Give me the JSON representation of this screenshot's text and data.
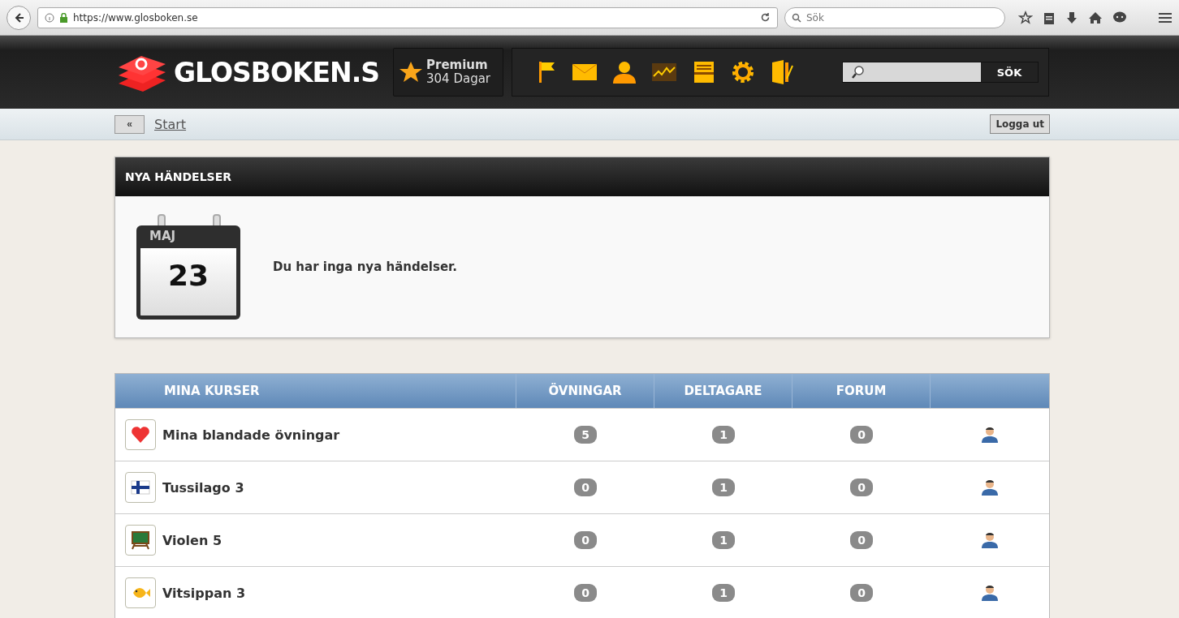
{
  "browser": {
    "url": "https://www.glosboken.se",
    "search_placeholder": "Sök"
  },
  "header": {
    "logo": "GLOSBOKEN.S",
    "premium": {
      "title": "Premium",
      "days": "304 Dagar"
    },
    "search": {
      "button": "SÖK"
    }
  },
  "breadcrumb": {
    "back": "«",
    "link": "Start",
    "logout": "Logga ut"
  },
  "events": {
    "title": "NYA HÄNDELSER",
    "calendar": {
      "month": "MAJ",
      "day": "23"
    },
    "message": "Du har inga nya händelser."
  },
  "courses": {
    "columns": [
      "MINA KURSER",
      "ÖVNINGAR",
      "DELTAGARE",
      "FORUM"
    ],
    "rows": [
      {
        "kind": "heart",
        "name": "Mina blandade övningar",
        "exercises": "5",
        "participants": "1",
        "forum": "0"
      },
      {
        "kind": "flag",
        "name": "Tussilago 3",
        "exercises": "0",
        "participants": "1",
        "forum": "0"
      },
      {
        "kind": "board",
        "name": "Violen 5",
        "exercises": "0",
        "participants": "1",
        "forum": "0"
      },
      {
        "kind": "fish",
        "name": "Vitsippan 3",
        "exercises": "0",
        "participants": "1",
        "forum": "0"
      }
    ]
  }
}
